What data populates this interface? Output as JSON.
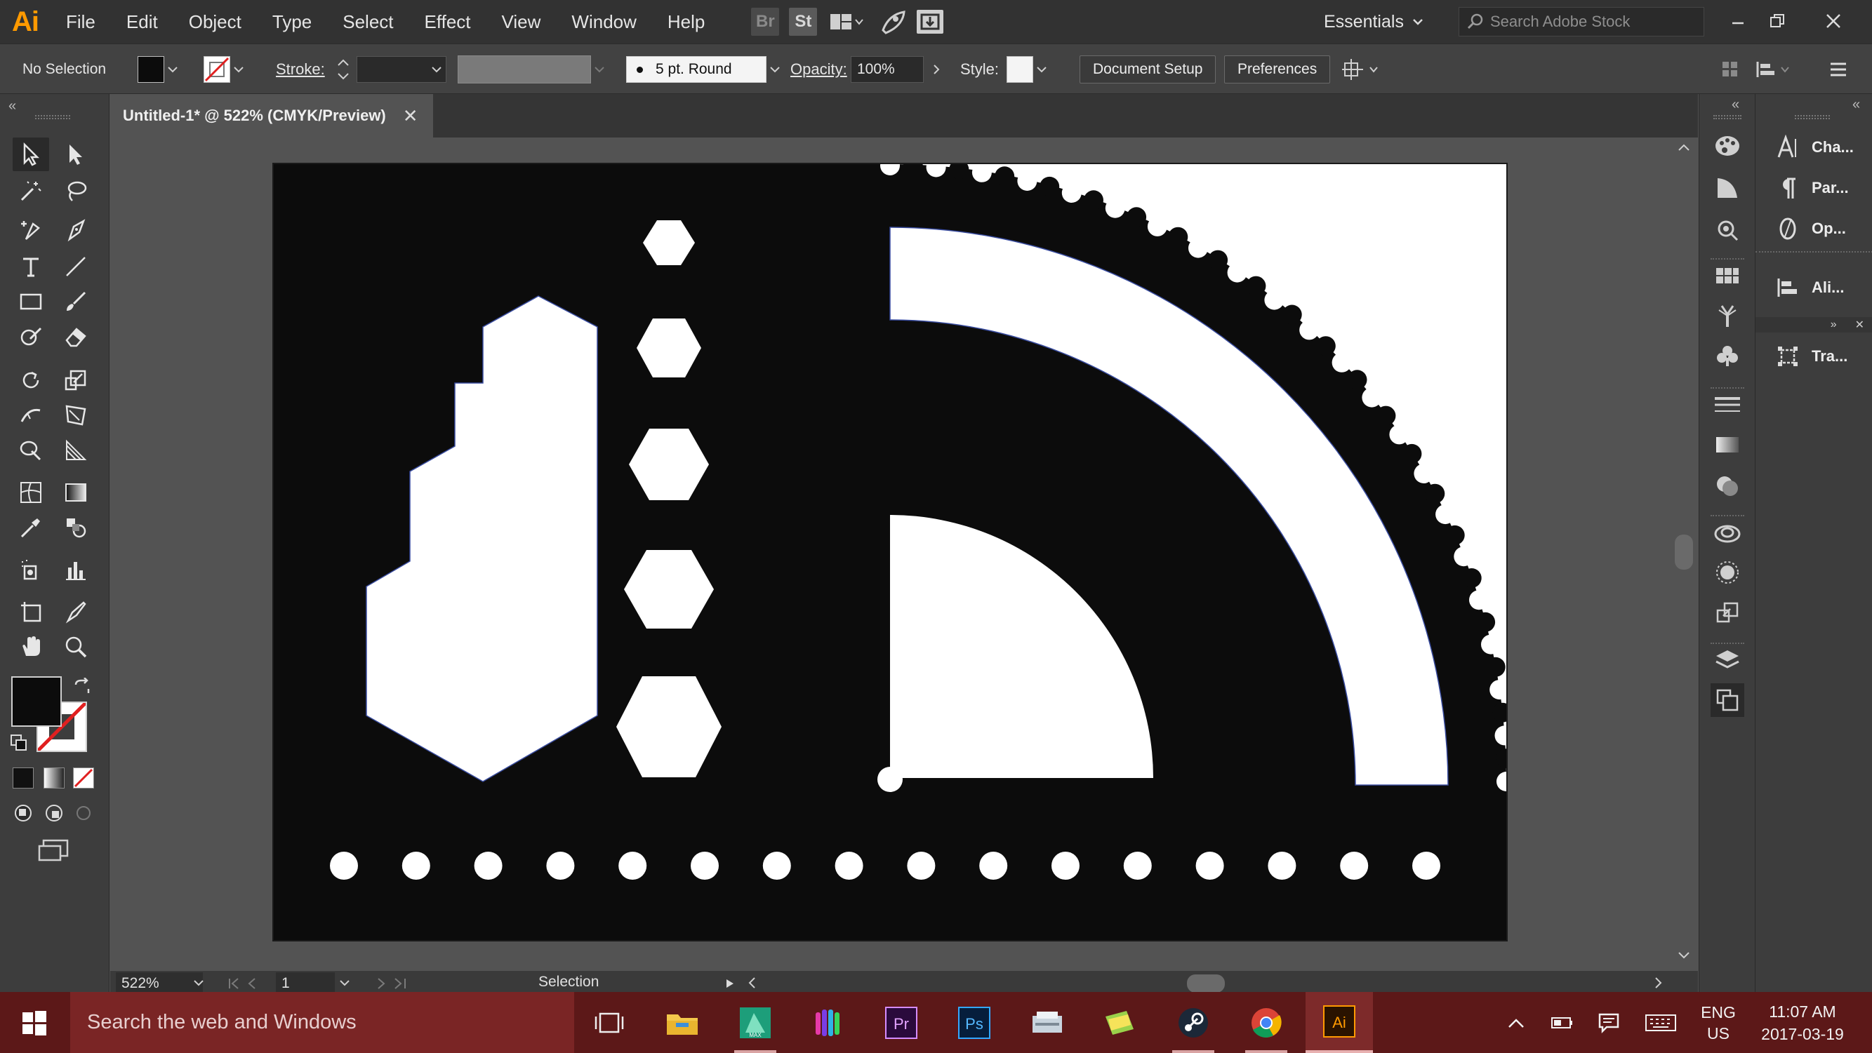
{
  "app": {
    "logo": "Ai",
    "accent": "#ff9a00"
  },
  "menu": {
    "items": [
      "File",
      "Edit",
      "Object",
      "Type",
      "Select",
      "Effect",
      "View",
      "Window",
      "Help"
    ],
    "bridge_label": "Br",
    "stock_label": "St"
  },
  "workspace": {
    "label": "Essentials"
  },
  "search": {
    "placeholder": "Search Adobe Stock"
  },
  "control_bar": {
    "selection_label": "No Selection",
    "fill_color": "#0c0c0c",
    "stroke_label": "Stroke:",
    "stroke_weight": "",
    "brush_label": "5 pt. Round",
    "opacity_label": "Opacity:",
    "opacity_value": "100%",
    "style_label": "Style:",
    "document_setup": "Document Setup",
    "preferences": "Preferences"
  },
  "document": {
    "tab_title": "Untitled-1* @ 522% (CMYK/Preview)",
    "close_glyph": "✕"
  },
  "status_bar": {
    "zoom": "522%",
    "artboard_number": "1",
    "status_text": "Selection"
  },
  "right_panels": {
    "items": [
      {
        "label": "Cha...",
        "icon": "character-icon"
      },
      {
        "label": "Par...",
        "icon": "paragraph-icon"
      },
      {
        "label": "Op...",
        "icon": "opentype-icon"
      },
      {
        "label": "Ali...",
        "icon": "align-icon"
      },
      {
        "label": "Tra...",
        "icon": "transform-icon"
      }
    ]
  },
  "taskbar": {
    "search_placeholder": "Search the web and Windows",
    "language": "ENG",
    "region": "US",
    "time": "11:07 AM",
    "date": "2017-03-19",
    "active_color": "#7d2a2a"
  }
}
